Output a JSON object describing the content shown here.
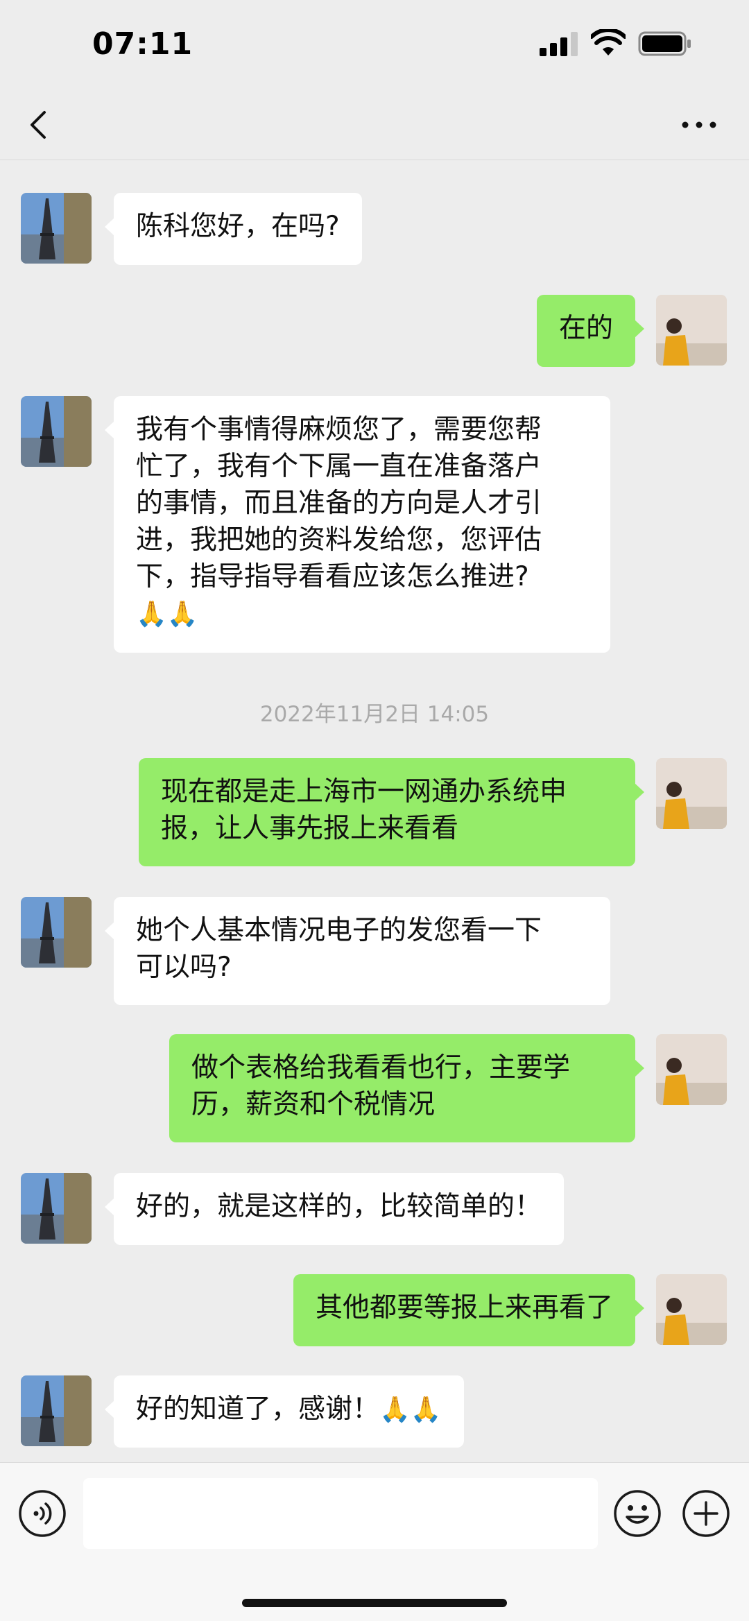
{
  "status_bar": {
    "time": "07:11"
  },
  "messages": [
    {
      "side": "in",
      "text": "陈科您好，在吗?"
    },
    {
      "side": "out",
      "text": "在的"
    },
    {
      "side": "in",
      "text": "我有个事情得麻烦您了，需要您帮\n忙了，我有个下属一直在准备落户\n的事情，而且准备的方向是人才引\n进，我把她的资料发给您，您评估\n下，指导指导看看应该怎么推进?",
      "emoji": "🙏🙏"
    },
    {
      "side": "out",
      "text": "现在都是走上海市一网通办系统申\n报，让人事先报上来看看"
    },
    {
      "side": "in",
      "text": "她个人基本情况电子的发您看一下\n可以吗?"
    },
    {
      "side": "out",
      "text": "做个表格给我看看也行，主要学\n历，薪资和个税情况"
    },
    {
      "side": "in",
      "text": "好的，就是这样的，比较简单的！"
    },
    {
      "side": "out",
      "text": "其他都要等报上来再看了"
    },
    {
      "side": "in",
      "text": "好的知道了，感谢！",
      "emoji": "🙏🙏"
    }
  ],
  "timestamp": "2022年11月2日 14:05",
  "colors": {
    "outgoing_bubble": "#95ec69",
    "incoming_bubble": "#ffffff",
    "background": "#ededed"
  },
  "icons": [
    "back-icon",
    "more-icon",
    "voice-icon",
    "emoji-icon",
    "plus-icon"
  ]
}
